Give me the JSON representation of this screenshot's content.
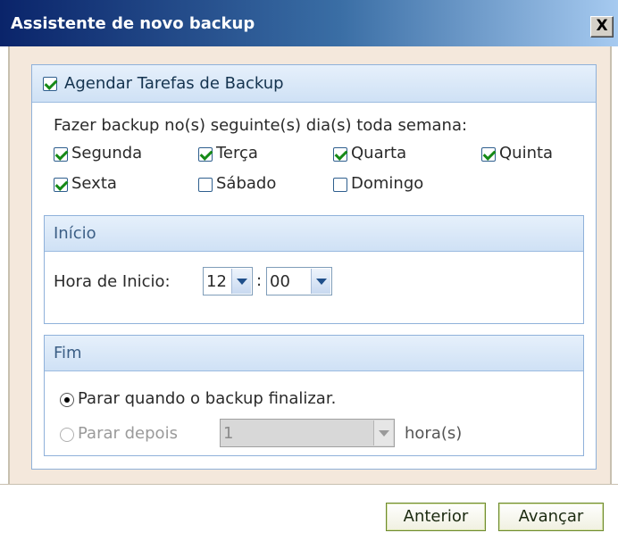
{
  "window": {
    "title": "Assistente de novo backup",
    "close_label": "X"
  },
  "schedule": {
    "label": "Agendar Tarefas de Backup",
    "checked": true,
    "instruction": "Fazer backup no(s) seguinte(s) dia(s) toda semana:",
    "days": [
      {
        "label": "Segunda",
        "checked": true
      },
      {
        "label": "Terça",
        "checked": true
      },
      {
        "label": "Quarta",
        "checked": true
      },
      {
        "label": "Quinta",
        "checked": true
      },
      {
        "label": "Sexta",
        "checked": true
      },
      {
        "label": "Sábado",
        "checked": false
      },
      {
        "label": "Domingo",
        "checked": false
      }
    ]
  },
  "start": {
    "label": "Início",
    "time_label": "Hora de Inicio:",
    "hour": "12",
    "separator": ":",
    "minute": "00"
  },
  "end": {
    "label": "Fim",
    "option_finish": "Parar quando o backup finalizar.",
    "option_after": "Parar depois",
    "after_value": "1",
    "after_unit": "hora(s)",
    "selected": "finish"
  },
  "buttons": {
    "back": "Anterior",
    "next": "Avançar"
  },
  "colors": {
    "title_bar_start": "#0a246a",
    "panel_header": "#cfe1f5",
    "check_color": "#168a16",
    "dialog_background": "#f4e8dc"
  }
}
